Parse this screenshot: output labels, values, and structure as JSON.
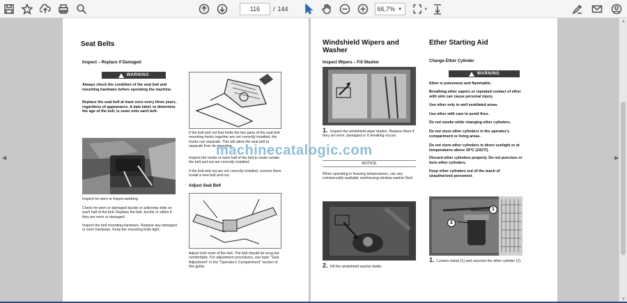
{
  "toolbar": {
    "page_current": "116",
    "page_separator": "/",
    "page_total": "144",
    "zoom": "66,7%"
  },
  "watermark": "machinecatalogic.com",
  "left_page": {
    "title": "Seat Belts",
    "section": "Inspect – Replace if Damaged",
    "warning_label": "WARNING",
    "warning_text_1": "Always check the condition of the seat belt and mounting hardware before operating the machine.",
    "warning_text_2": "Replace the seat belt at least once every three years, regardless of appearance. A date label, to determine the age of the belt, is sewn onto each belt.",
    "caption_wear": "Inspect for worn or frayed webbing.",
    "caption_buckle": "Check for worn or damaged buckle or anticreep slide on each half of the belt. Replace the belt, buckle or slides if they are worn or damaged.",
    "caption_hardware": "Inspect the belt mounting hardware. Replace any damaged or worn hardware. Keep the mounting bolts tight.",
    "caption_bolt": "If the bolt and nut that holds the two parts of the seat belt mounting hooks together are not correctly installed, the hooks can separate. This will allow the seat belt to separate from its mounting.",
    "caption_hooks": "Inspect the hooks of each half of the belt to make certain the bolt and nut are correctly installed.",
    "caption_replace": "If the bolt and nut are not correctly installed, remove them. Install a new bolt and nut.",
    "adjust_title": "Adjust Seat Belt",
    "caption_adjust": "Adjust both ends of the belt. The belt should be snug but comfortable. For adjustment procedures, see topic \"Seat Adjustment\" in the \"Operator's Compartment\" section of this guide."
  },
  "right_page": {
    "wiper_title_1": "Windshield Wipers and",
    "wiper_title_2": "Washer",
    "wiper_section": "Inspect Wipers – Fill Washer",
    "wiper_step1_num": "1.",
    "wiper_step1": "Inspect the windshield wiper blades. Replace them if they are worn, damaged or if streaking occurs.",
    "notice_label": "NOTICE",
    "notice_text": "When operating in freezing temperatures, use any commercially available nonfreezing window washer fluid.",
    "wiper_step2_num": "2.",
    "wiper_step2": "Fill the windshield washer bottle.",
    "ether_title": "Ether Starting Aid",
    "ether_section": "Change Ether Cylinder",
    "warning_label": "WARNING",
    "ether_warnings": [
      "Ether is poisonous and flammable.",
      "Breathing ether vapors or repeated contact of ether with skin can cause personal injury.",
      "Use ether only in well ventilated areas.",
      "Use ether with care to avoid fires.",
      "Do not smoke while changing ether cylinders.",
      "Do not store ether cylinders in the operator's compartment or living areas.",
      "Do not store ether cylinders in direct sunlight or at temperatures above 39°C (102°F).",
      "Discard ether cylinders properly. Do not puncture or burn ether cylinders.",
      "Keep ether cylinders out of the reach of unauthorized personnel."
    ],
    "ether_step1_num": "1.",
    "ether_step1": "Loosen clamp (1) and unscrew the ether cylinder (2).",
    "callout_1": "1",
    "callout_2": "2"
  }
}
